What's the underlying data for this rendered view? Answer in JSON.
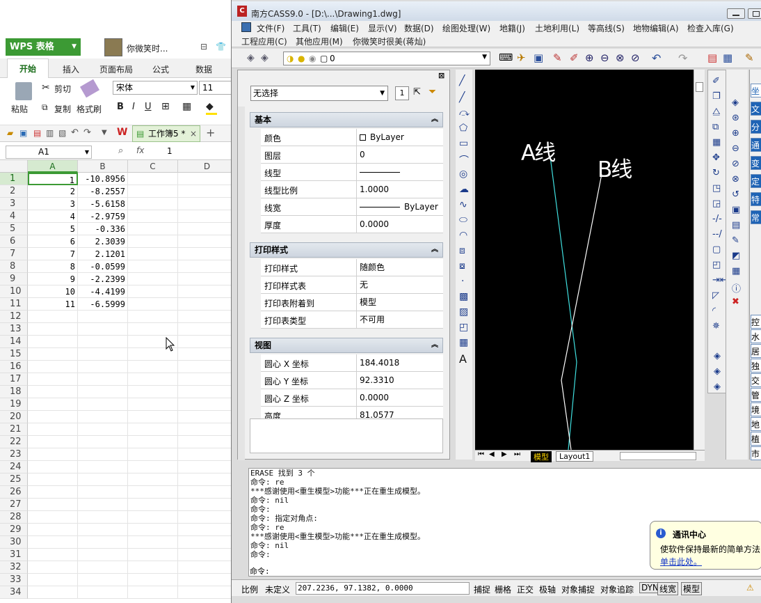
{
  "wps": {
    "logo": "WPS 表格",
    "username": "你微笑时...",
    "tabs": [
      "开始",
      "插入",
      "页面布局",
      "公式",
      "数据"
    ],
    "ribbon": {
      "paste": "粘贴",
      "cut": "剪切",
      "copy": "复制",
      "format_painter": "格式刷",
      "font": "宋体",
      "font_size": "11",
      "bold": "B",
      "italic": "I",
      "underline": "U"
    },
    "doc_tab": "工作簿5 *",
    "namebox": "A1",
    "fx": "fx",
    "formula_value": "1",
    "columns": [
      "A",
      "B",
      "C",
      "D"
    ],
    "rows": [
      {
        "n": "1",
        "a": "1",
        "b": "-10.8956"
      },
      {
        "n": "2",
        "a": "2",
        "b": "-8.2557"
      },
      {
        "n": "3",
        "a": "3",
        "b": "-5.6158"
      },
      {
        "n": "4",
        "a": "4",
        "b": "-2.9759"
      },
      {
        "n": "5",
        "a": "5",
        "b": "-0.336"
      },
      {
        "n": "6",
        "a": "6",
        "b": "2.3039"
      },
      {
        "n": "7",
        "a": "7",
        "b": "2.1201"
      },
      {
        "n": "8",
        "a": "8",
        "b": "-0.0599"
      },
      {
        "n": "9",
        "a": "9",
        "b": "-2.2399"
      },
      {
        "n": "10",
        "a": "10",
        "b": "-4.4199"
      },
      {
        "n": "11",
        "a": "11",
        "b": "-6.5999"
      },
      {
        "n": "12",
        "a": "",
        "b": ""
      },
      {
        "n": "13",
        "a": "",
        "b": ""
      },
      {
        "n": "14",
        "a": "",
        "b": ""
      },
      {
        "n": "15",
        "a": "",
        "b": ""
      },
      {
        "n": "16",
        "a": "",
        "b": ""
      },
      {
        "n": "17",
        "a": "",
        "b": ""
      },
      {
        "n": "18",
        "a": "",
        "b": ""
      },
      {
        "n": "19",
        "a": "",
        "b": ""
      },
      {
        "n": "20",
        "a": "",
        "b": ""
      },
      {
        "n": "21",
        "a": "",
        "b": ""
      },
      {
        "n": "22",
        "a": "",
        "b": ""
      },
      {
        "n": "23",
        "a": "",
        "b": ""
      },
      {
        "n": "24",
        "a": "",
        "b": ""
      },
      {
        "n": "25",
        "a": "",
        "b": ""
      },
      {
        "n": "26",
        "a": "",
        "b": ""
      },
      {
        "n": "27",
        "a": "",
        "b": ""
      },
      {
        "n": "28",
        "a": "",
        "b": ""
      },
      {
        "n": "29",
        "a": "",
        "b": ""
      },
      {
        "n": "30",
        "a": "",
        "b": ""
      },
      {
        "n": "31",
        "a": "",
        "b": ""
      },
      {
        "n": "32",
        "a": "",
        "b": ""
      },
      {
        "n": "33",
        "a": "",
        "b": ""
      },
      {
        "n": "34",
        "a": "",
        "b": ""
      }
    ]
  },
  "cass": {
    "title": "南方CASS9.0 - [D:\\...\\Drawing1.dwg]",
    "menu_row1": [
      "文件(F)",
      "工具(T)",
      "编辑(E)",
      "显示(V)",
      "数据(D)",
      "绘图处理(W)",
      "地籍(J)",
      "土地利用(L)",
      "等高线(S)",
      "地物编辑(A)",
      "检查入库(G)"
    ],
    "menu_row2": [
      "工程应用(C)",
      "其他应用(M)",
      "你微笑时很美(蒋灿)"
    ],
    "layer_value": "0",
    "select_value": "无选择",
    "sections": {
      "basic": "基本",
      "print": "打印样式",
      "view": "视图"
    },
    "basic_props": [
      {
        "name": "颜色",
        "value": "ByLayer"
      },
      {
        "name": "图层",
        "value": "0"
      },
      {
        "name": "线型",
        "value": "Continuous"
      },
      {
        "name": "线型比例",
        "value": "1.0000"
      },
      {
        "name": "线宽",
        "value": "ByLayer"
      },
      {
        "name": "厚度",
        "value": "0.0000"
      }
    ],
    "print_props": [
      {
        "name": "打印样式",
        "value": "随颜色"
      },
      {
        "name": "打印样式表",
        "value": "无"
      },
      {
        "name": "打印表附着到",
        "value": "模型"
      },
      {
        "name": "打印表类型",
        "value": "不可用"
      }
    ],
    "view_props": [
      {
        "name": "圆心 X 坐标",
        "value": "184.4018"
      },
      {
        "name": "圆心 Y 坐标",
        "value": "92.3310"
      },
      {
        "name": "圆心 Z 坐标",
        "value": "0.0000"
      },
      {
        "name": "高度",
        "value": "81.0577"
      }
    ],
    "drawing": {
      "label_a": "A线",
      "label_b": "B线",
      "color_a": "#40e0e0",
      "color_b": "#ffffff"
    },
    "layout_tabs": [
      "模型",
      "Layout1"
    ],
    "right_panel_items": [
      "坐",
      "文",
      "分",
      "通",
      "变",
      "定",
      "特",
      "常",
      "控",
      "水",
      "居",
      "独",
      "交",
      "管",
      "境",
      "地",
      "植",
      "市"
    ],
    "command_lines": [
      "ERASE 找到 3 个",
      "命令: re",
      "***感谢使用<重生模型>功能***正在重生成模型。",
      "命令: nil",
      "命令:",
      "命令: 指定对角点:",
      "命令: re",
      "***感谢使用<重生模型>功能***正在重生成模型。",
      "命令: nil",
      "命令:"
    ],
    "command_prompt": "命令:",
    "status": {
      "scale_label": "比例",
      "scale_value": "未定义",
      "coords": "207.2236,  97.1382,  0.0000",
      "toggles": [
        "捕捉",
        "栅格",
        "正交",
        "极轴",
        "对象捕捉",
        "对象追踪",
        "DYN",
        "线宽",
        "模型"
      ]
    },
    "notify": {
      "title": "通讯中心",
      "body": "使软件保持最新的简单方法",
      "link": "单击此处。"
    }
  }
}
